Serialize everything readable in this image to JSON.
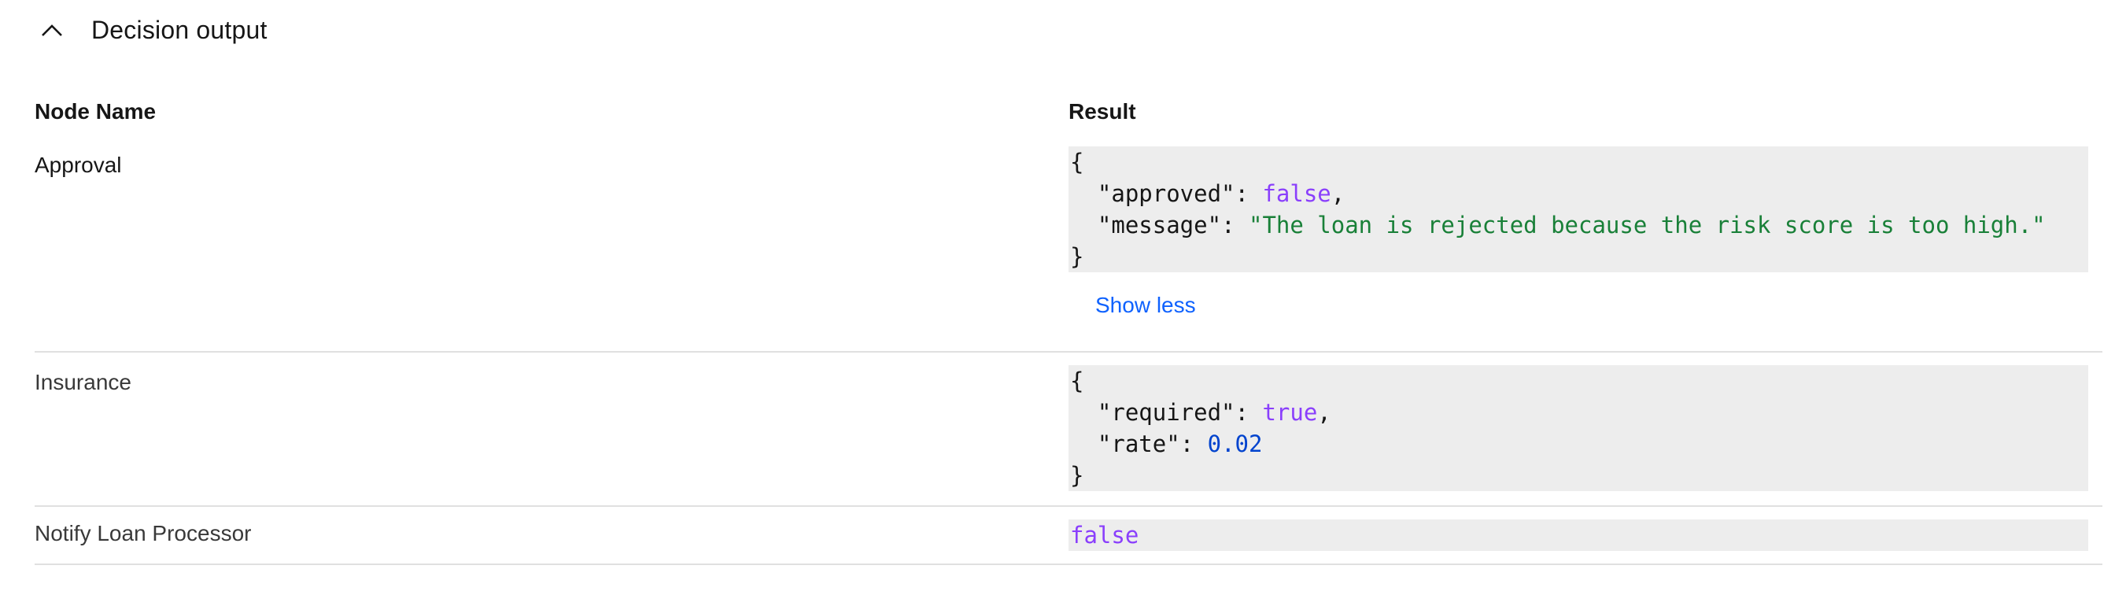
{
  "section": {
    "title": "Decision output",
    "toggle_icon": "chevron-up-icon"
  },
  "table": {
    "columns": [
      "Node Name",
      "Result"
    ],
    "rows": [
      {
        "name": "Approval",
        "result_lines": [
          "{",
          "\"approved\": false,",
          "\"message\": \"The loan is rejected because the risk score is too high.\"",
          "}"
        ],
        "approved_key": "\"approved\"",
        "approved_value": "false",
        "message_key": "\"message\"",
        "message_value": "\"The loan is rejected because the risk score is too high.\"",
        "toggle_label": "Show less"
      },
      {
        "name": "Insurance",
        "required_key": "\"required\"",
        "required_value": "true",
        "rate_key": "\"rate\"",
        "rate_value": "0.02"
      },
      {
        "name": "Notify Loan Processor",
        "value": "false"
      }
    ]
  },
  "colors": {
    "keyword": "#8a3ffc",
    "string": "#198038",
    "number": "#0043ce",
    "link": "#0f62fe",
    "code_background": "#ededed"
  }
}
